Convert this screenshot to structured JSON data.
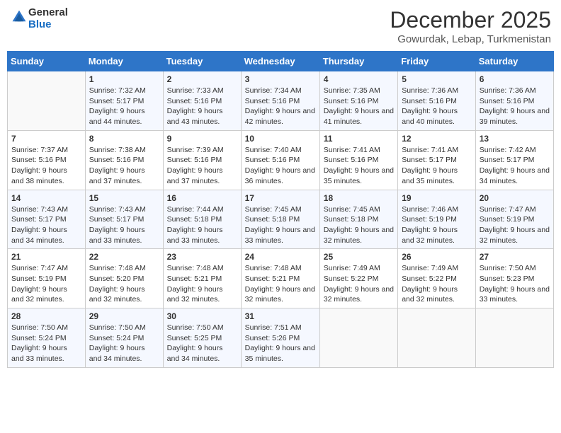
{
  "logo": {
    "line1": "General",
    "line2": "Blue"
  },
  "title": "December 2025",
  "location": "Gowurdak, Lebap, Turkmenistan",
  "days_of_week": [
    "Sunday",
    "Monday",
    "Tuesday",
    "Wednesday",
    "Thursday",
    "Friday",
    "Saturday"
  ],
  "weeks": [
    [
      {
        "date": "",
        "sunrise": "",
        "sunset": "",
        "daylight": ""
      },
      {
        "date": "1",
        "sunrise": "Sunrise: 7:32 AM",
        "sunset": "Sunset: 5:17 PM",
        "daylight": "Daylight: 9 hours and 44 minutes."
      },
      {
        "date": "2",
        "sunrise": "Sunrise: 7:33 AM",
        "sunset": "Sunset: 5:16 PM",
        "daylight": "Daylight: 9 hours and 43 minutes."
      },
      {
        "date": "3",
        "sunrise": "Sunrise: 7:34 AM",
        "sunset": "Sunset: 5:16 PM",
        "daylight": "Daylight: 9 hours and 42 minutes."
      },
      {
        "date": "4",
        "sunrise": "Sunrise: 7:35 AM",
        "sunset": "Sunset: 5:16 PM",
        "daylight": "Daylight: 9 hours and 41 minutes."
      },
      {
        "date": "5",
        "sunrise": "Sunrise: 7:36 AM",
        "sunset": "Sunset: 5:16 PM",
        "daylight": "Daylight: 9 hours and 40 minutes."
      },
      {
        "date": "6",
        "sunrise": "Sunrise: 7:36 AM",
        "sunset": "Sunset: 5:16 PM",
        "daylight": "Daylight: 9 hours and 39 minutes."
      }
    ],
    [
      {
        "date": "7",
        "sunrise": "Sunrise: 7:37 AM",
        "sunset": "Sunset: 5:16 PM",
        "daylight": "Daylight: 9 hours and 38 minutes."
      },
      {
        "date": "8",
        "sunrise": "Sunrise: 7:38 AM",
        "sunset": "Sunset: 5:16 PM",
        "daylight": "Daylight: 9 hours and 37 minutes."
      },
      {
        "date": "9",
        "sunrise": "Sunrise: 7:39 AM",
        "sunset": "Sunset: 5:16 PM",
        "daylight": "Daylight: 9 hours and 37 minutes."
      },
      {
        "date": "10",
        "sunrise": "Sunrise: 7:40 AM",
        "sunset": "Sunset: 5:16 PM",
        "daylight": "Daylight: 9 hours and 36 minutes."
      },
      {
        "date": "11",
        "sunrise": "Sunrise: 7:41 AM",
        "sunset": "Sunset: 5:16 PM",
        "daylight": "Daylight: 9 hours and 35 minutes."
      },
      {
        "date": "12",
        "sunrise": "Sunrise: 7:41 AM",
        "sunset": "Sunset: 5:17 PM",
        "daylight": "Daylight: 9 hours and 35 minutes."
      },
      {
        "date": "13",
        "sunrise": "Sunrise: 7:42 AM",
        "sunset": "Sunset: 5:17 PM",
        "daylight": "Daylight: 9 hours and 34 minutes."
      }
    ],
    [
      {
        "date": "14",
        "sunrise": "Sunrise: 7:43 AM",
        "sunset": "Sunset: 5:17 PM",
        "daylight": "Daylight: 9 hours and 34 minutes."
      },
      {
        "date": "15",
        "sunrise": "Sunrise: 7:43 AM",
        "sunset": "Sunset: 5:17 PM",
        "daylight": "Daylight: 9 hours and 33 minutes."
      },
      {
        "date": "16",
        "sunrise": "Sunrise: 7:44 AM",
        "sunset": "Sunset: 5:18 PM",
        "daylight": "Daylight: 9 hours and 33 minutes."
      },
      {
        "date": "17",
        "sunrise": "Sunrise: 7:45 AM",
        "sunset": "Sunset: 5:18 PM",
        "daylight": "Daylight: 9 hours and 33 minutes."
      },
      {
        "date": "18",
        "sunrise": "Sunrise: 7:45 AM",
        "sunset": "Sunset: 5:18 PM",
        "daylight": "Daylight: 9 hours and 32 minutes."
      },
      {
        "date": "19",
        "sunrise": "Sunrise: 7:46 AM",
        "sunset": "Sunset: 5:19 PM",
        "daylight": "Daylight: 9 hours and 32 minutes."
      },
      {
        "date": "20",
        "sunrise": "Sunrise: 7:47 AM",
        "sunset": "Sunset: 5:19 PM",
        "daylight": "Daylight: 9 hours and 32 minutes."
      }
    ],
    [
      {
        "date": "21",
        "sunrise": "Sunrise: 7:47 AM",
        "sunset": "Sunset: 5:19 PM",
        "daylight": "Daylight: 9 hours and 32 minutes."
      },
      {
        "date": "22",
        "sunrise": "Sunrise: 7:48 AM",
        "sunset": "Sunset: 5:20 PM",
        "daylight": "Daylight: 9 hours and 32 minutes."
      },
      {
        "date": "23",
        "sunrise": "Sunrise: 7:48 AM",
        "sunset": "Sunset: 5:21 PM",
        "daylight": "Daylight: 9 hours and 32 minutes."
      },
      {
        "date": "24",
        "sunrise": "Sunrise: 7:48 AM",
        "sunset": "Sunset: 5:21 PM",
        "daylight": "Daylight: 9 hours and 32 minutes."
      },
      {
        "date": "25",
        "sunrise": "Sunrise: 7:49 AM",
        "sunset": "Sunset: 5:22 PM",
        "daylight": "Daylight: 9 hours and 32 minutes."
      },
      {
        "date": "26",
        "sunrise": "Sunrise: 7:49 AM",
        "sunset": "Sunset: 5:22 PM",
        "daylight": "Daylight: 9 hours and 32 minutes."
      },
      {
        "date": "27",
        "sunrise": "Sunrise: 7:50 AM",
        "sunset": "Sunset: 5:23 PM",
        "daylight": "Daylight: 9 hours and 33 minutes."
      }
    ],
    [
      {
        "date": "28",
        "sunrise": "Sunrise: 7:50 AM",
        "sunset": "Sunset: 5:24 PM",
        "daylight": "Daylight: 9 hours and 33 minutes."
      },
      {
        "date": "29",
        "sunrise": "Sunrise: 7:50 AM",
        "sunset": "Sunset: 5:24 PM",
        "daylight": "Daylight: 9 hours and 34 minutes."
      },
      {
        "date": "30",
        "sunrise": "Sunrise: 7:50 AM",
        "sunset": "Sunset: 5:25 PM",
        "daylight": "Daylight: 9 hours and 34 minutes."
      },
      {
        "date": "31",
        "sunrise": "Sunrise: 7:51 AM",
        "sunset": "Sunset: 5:26 PM",
        "daylight": "Daylight: 9 hours and 35 minutes."
      },
      {
        "date": "",
        "sunrise": "",
        "sunset": "",
        "daylight": ""
      },
      {
        "date": "",
        "sunrise": "",
        "sunset": "",
        "daylight": ""
      },
      {
        "date": "",
        "sunrise": "",
        "sunset": "",
        "daylight": ""
      }
    ]
  ]
}
